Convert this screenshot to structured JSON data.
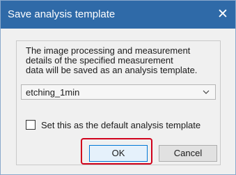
{
  "dialog": {
    "title": "Save analysis template",
    "close_glyph": "✕",
    "description_lines": [
      "The image processing and measurement",
      "details of the specified measurement",
      "data will be saved as an analysis template."
    ],
    "template_select": {
      "selected_value": "etching_1min",
      "icon": "chevron-down-icon"
    },
    "default_checkbox": {
      "label": "Set this as the default analysis template",
      "checked": false
    },
    "buttons": {
      "ok_label": "OK",
      "cancel_label": "Cancel"
    },
    "colors": {
      "titlebar": "#2f6aa8",
      "highlight": "#d0021b",
      "focus": "#0078d7"
    }
  }
}
